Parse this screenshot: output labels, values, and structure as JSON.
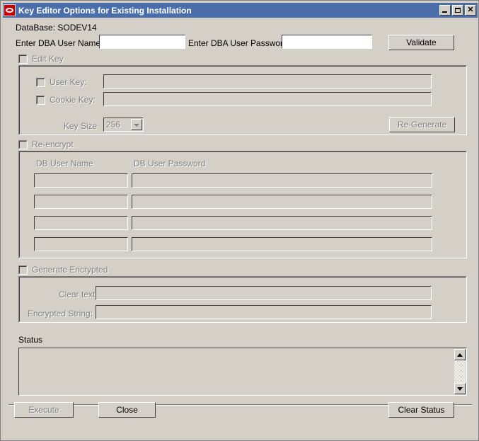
{
  "window": {
    "title": "Key Editor Options for Existing Installation",
    "app_icon": "oracle-logo-icon",
    "minimize_label": "",
    "maximize_label": "",
    "close_label": "✕",
    "titlebar_color": "#4a6ea9",
    "dialog_color": "#d4d0c8"
  },
  "header": {
    "database_label": "DataBase: SODEV14",
    "dba_user_name_label": "Enter DBA User Name:",
    "dba_user_name_value": "",
    "dba_user_password_label": "Enter DBA User Password:",
    "dba_user_password_value": "",
    "validate_button": "Validate"
  },
  "edit_key": {
    "group_checkbox_label": "Edit Key",
    "checked": false,
    "user_key_label": "User Key:",
    "user_key_checked": false,
    "user_key_value": "",
    "cookie_key_label": "Cookie Key:",
    "cookie_key_checked": false,
    "cookie_key_value": "",
    "key_size_label": "Key Size",
    "key_size_value": "256",
    "key_size_options": [
      "256"
    ],
    "regenerate_button": "Re-Generate"
  },
  "re_encrypt": {
    "group_checkbox_label": "Re-encrypt",
    "checked": false,
    "col_user_name": "DB User Name",
    "col_user_password": "DB User Password",
    "rows": [
      {
        "user_name": "",
        "user_password": ""
      },
      {
        "user_name": "",
        "user_password": ""
      },
      {
        "user_name": "",
        "user_password": ""
      },
      {
        "user_name": "",
        "user_password": ""
      }
    ]
  },
  "generate_encrypted": {
    "group_checkbox_label": "Generate Encrypted",
    "checked": false,
    "clear_text_label": "Clear text:",
    "clear_text_value": "",
    "encrypted_string_label": "Encrypted String:",
    "encrypted_string_value": ""
  },
  "status": {
    "label": "Status",
    "content": "",
    "scroll_up_icon": "scroll-up-arrow-icon",
    "scroll_down_icon": "scroll-down-arrow-icon"
  },
  "footer": {
    "execute_button": "Execute",
    "execute_enabled": false,
    "close_button": "Close",
    "clear_status_button": "Clear Status"
  }
}
